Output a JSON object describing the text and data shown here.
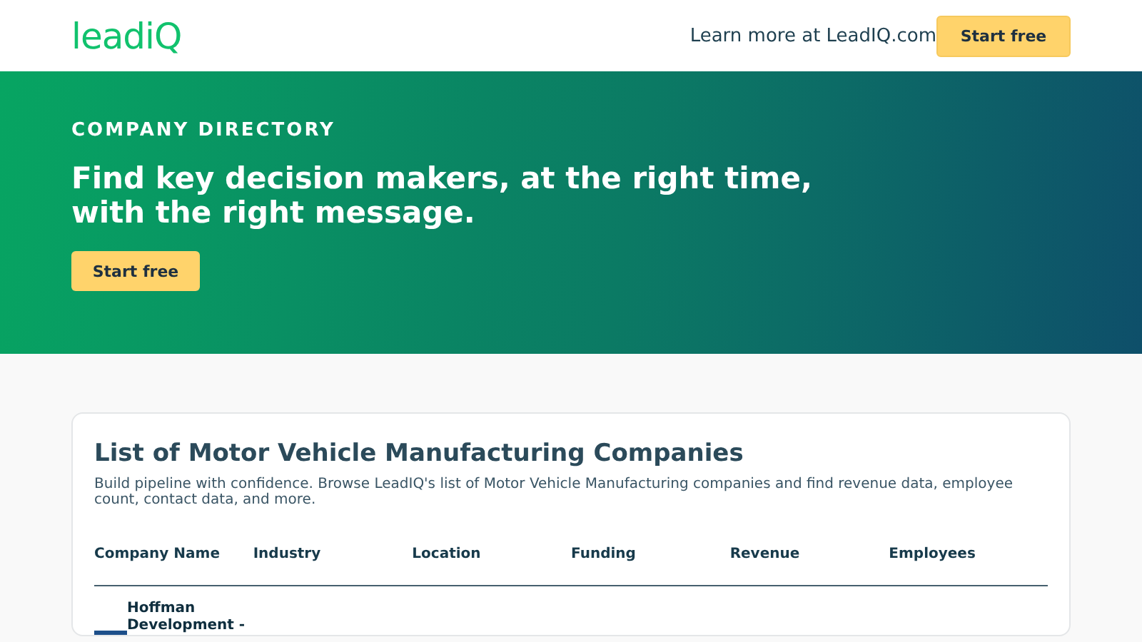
{
  "header": {
    "logo": "leadiQ",
    "link": "Learn more at LeadIQ.com",
    "button": "Start free"
  },
  "hero": {
    "eyebrow": "COMPANY DIRECTORY",
    "headline": "Find key decision makers, at the right time, with the right message.",
    "button": "Start free"
  },
  "card": {
    "title": "List of Motor Vehicle Manufacturing Companies",
    "description": "Build pipeline with confidence. Browse LeadIQ's list of Motor Vehicle Manufacturing companies and find revenue data, employee count, contact data, and more.",
    "table": {
      "columns": [
        "Company Name",
        "Industry",
        "Location",
        "Funding",
        "Revenue",
        "Employees"
      ],
      "rows": [
        {
          "name": "Hoffman Development -"
        }
      ]
    }
  }
}
